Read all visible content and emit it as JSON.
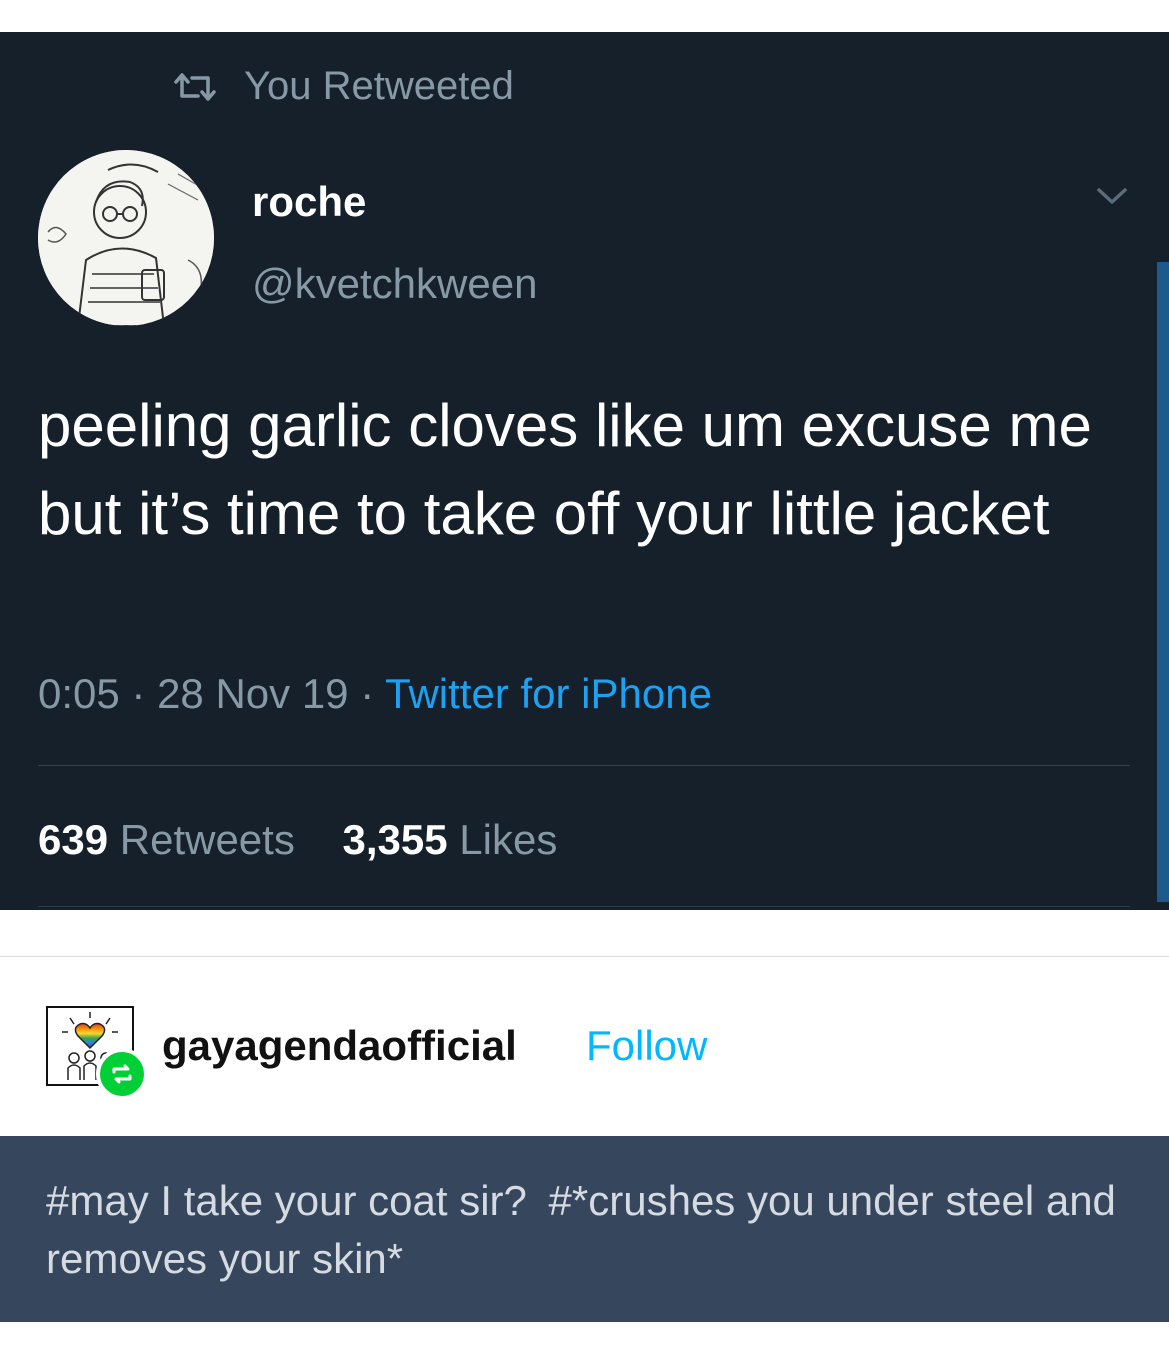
{
  "tweet": {
    "retweet_context": "You Retweeted",
    "display_name": "roche",
    "handle": "@kvetchkween",
    "text": "peeling garlic cloves like um excuse me but it’s time to take off your little jacket",
    "time": "0:05",
    "date": "28 Nov 19",
    "source": "Twitter for iPhone",
    "retweets_count": "639",
    "retweets_label": "Retweets",
    "likes_count": "3,355",
    "likes_label": "Likes",
    "background": "#15202b",
    "accent": "#1da1f2"
  },
  "tumblr": {
    "blog_name": "gayagendaofficial",
    "follow_label": "Follow",
    "tags": [
      "#may I take your coat sir?",
      "#*crushes you under steel and removes your skin*"
    ],
    "tags_background": "#36465d",
    "reblog_badge_color": "#00cf35"
  },
  "icons": {
    "retweet": "retweet-icon",
    "chevron": "chevron-down-icon",
    "reblog": "reblog-icon"
  }
}
